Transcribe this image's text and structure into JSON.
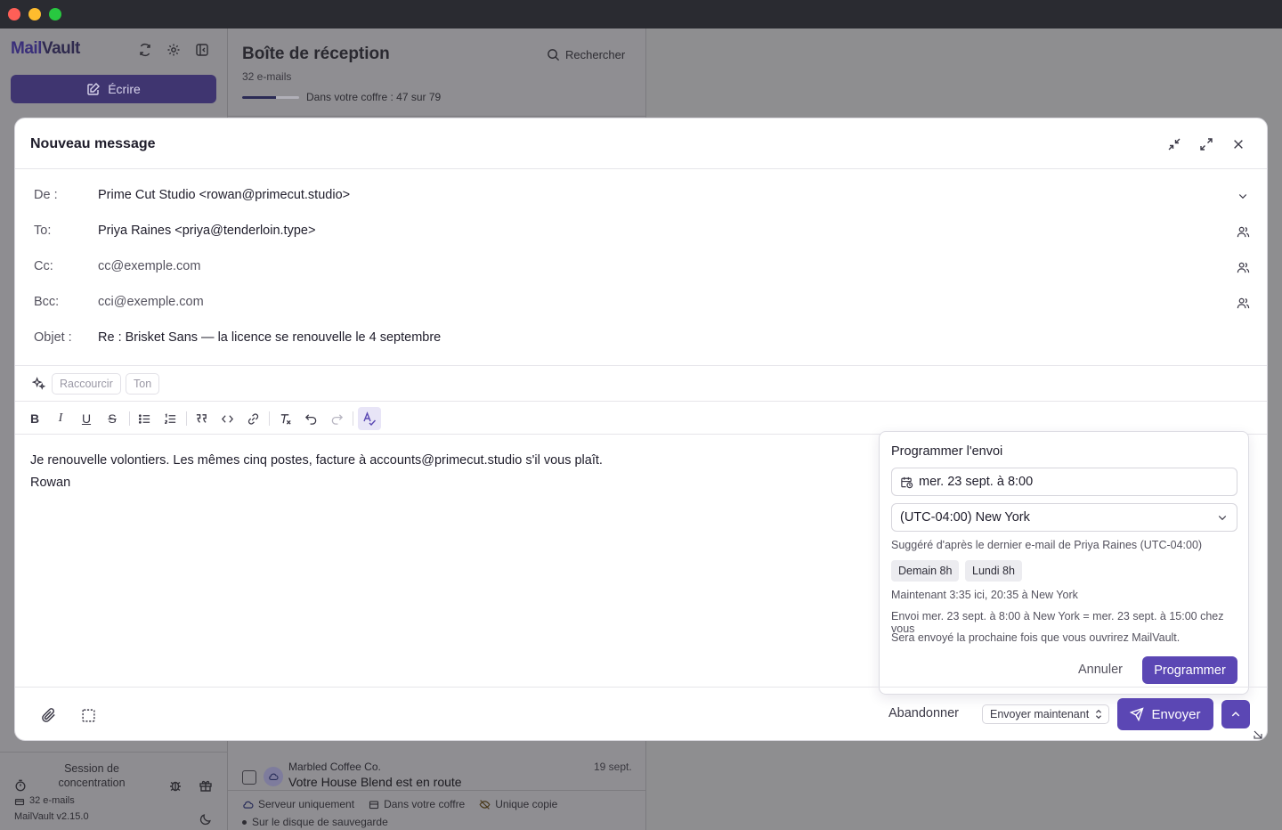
{
  "app": {
    "brand_prefix": "Mail",
    "brand_suffix": "Vault",
    "compose_label": "Écrire"
  },
  "sidebar": {
    "focus_session": "Session de concentration",
    "email_count": "32 e-mails",
    "version": "MailVault v2.15.0"
  },
  "inbox": {
    "title": "Boîte de réception",
    "count": "32 e-mails",
    "vault_progress_text": "Dans votre coffre : 47 sur 79",
    "vault_fraction": 0.595,
    "search_label": "Rechercher",
    "row": {
      "sender": "Marbled Coffee Co.",
      "subject": "Votre House Blend est en route",
      "date": "19 sept.",
      "tag_server": "Serveur uniquement",
      "tag_vault": "Dans votre coffre",
      "tag_unique": "Unique copie",
      "tag_backup": "Sur le disque de sauvegarde"
    }
  },
  "compose": {
    "title": "Nouveau message",
    "from_label": "De :",
    "from_value": "Prime Cut Studio <rowan@primecut.studio>",
    "to_label": "To:",
    "to_value": "Priya Raines <priya@tenderloin.type>",
    "cc_label": "Cc:",
    "cc_placeholder": "cc@exemple.com",
    "bcc_label": "Bcc:",
    "bcc_placeholder": "cci@exemple.com",
    "subject_label": "Objet :",
    "subject_value": "Re : Brisket Sans — la licence se renouvelle le 4 septembre",
    "ai_shorten": "Raccourcir",
    "ai_tone": "Ton",
    "body_line1": "Je renouvelle volontiers. Les mêmes cinq postes, facture à accounts@primecut.studio s'il vous plaît.",
    "body_line2": "Rowan",
    "abandon": "Abandonner",
    "send_mode": "Envoyer maintenant",
    "send": "Envoyer"
  },
  "schedule": {
    "title": "Programmer l'envoi",
    "datetime": "mer. 23 sept. à 8:00",
    "timezone": "(UTC-04:00) New York",
    "suggestion": "Suggéré d'après le dernier e-mail de Priya Raines (UTC-04:00)",
    "chip_tomorrow": "Demain 8h",
    "chip_monday": "Lundi 8h",
    "now_text": "Maintenant 3:35 ici, 20:35 à New York",
    "send_text": "Envoi mer. 23 sept. à 8:00 à New York = mer. 23 sept. à 15:00 chez vous",
    "offline_text": "Sera envoyé la prochaine fois que vous ouvrirez MailVault.",
    "cancel": "Annuler",
    "confirm": "Programmer"
  },
  "colors": {
    "accent": "#5b47b4",
    "titlebar": "#2a2b31"
  }
}
